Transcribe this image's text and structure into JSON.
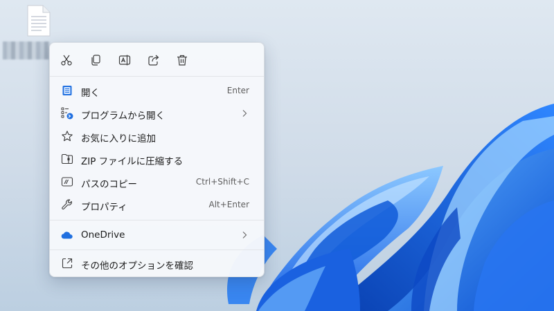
{
  "desktop": {
    "accent": "#1f6fe0",
    "file_icon": "text-file-icon"
  },
  "toolbar": {
    "buttons": [
      {
        "name": "cut",
        "icon": "scissors-icon"
      },
      {
        "name": "copy",
        "icon": "copy-icon"
      },
      {
        "name": "rename",
        "icon": "rename-icon"
      },
      {
        "name": "share",
        "icon": "share-icon"
      },
      {
        "name": "delete",
        "icon": "trash-icon"
      }
    ]
  },
  "menu": {
    "items": [
      {
        "label": "開く",
        "shortcut": "Enter",
        "icon": "notepad-icon"
      },
      {
        "label": "プログラムから開く",
        "shortcut": "",
        "icon": "open-with-icon",
        "submenu": true
      },
      {
        "label": "お気に入りに追加",
        "shortcut": "",
        "icon": "star-icon"
      },
      {
        "label": "ZIP ファイルに圧縮する",
        "shortcut": "",
        "icon": "zip-folder-icon"
      },
      {
        "label": "パスのコピー",
        "shortcut": "Ctrl+Shift+C",
        "icon": "copy-path-icon"
      },
      {
        "label": "プロパティ",
        "shortcut": "Alt+Enter",
        "icon": "wrench-icon"
      },
      {
        "label": "OneDrive",
        "shortcut": "",
        "icon": "onedrive-cloud-icon",
        "submenu": true
      },
      {
        "label": "その他のオプションを確認",
        "shortcut": "",
        "icon": "more-options-icon"
      }
    ]
  }
}
